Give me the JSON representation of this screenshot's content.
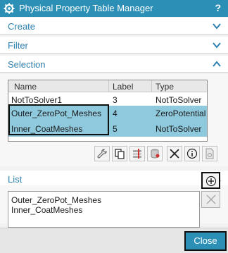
{
  "window": {
    "title": "Physical Property Table Manager",
    "help_label": "?"
  },
  "sections": {
    "create": {
      "label": "Create"
    },
    "filter": {
      "label": "Filter"
    },
    "selection": {
      "label": "Selection"
    },
    "list": {
      "label": "List"
    }
  },
  "table": {
    "columns": [
      "Name",
      "Label",
      "Type"
    ],
    "rows": [
      {
        "name": "NotToSolver1",
        "label": "3",
        "type": "NotToSolver",
        "selected": false
      },
      {
        "name": "Outer_ZeroPot_Meshes",
        "label": "4",
        "type": "ZeroPotential",
        "selected": true
      },
      {
        "name": "Inner_CoatMeshes",
        "label": "5",
        "type": "NotToSolver",
        "selected": true
      }
    ]
  },
  "toolbar": {
    "icons": [
      "wrench-icon",
      "copy-icon",
      "table-edit-icon",
      "database-icon",
      "delete-icon",
      "info-icon",
      "document-icon"
    ]
  },
  "list": {
    "items": [
      "Outer_ZeroPot_Meshes",
      "Inner_CoatMeshes"
    ]
  },
  "footer": {
    "close_label": "Close"
  },
  "colors": {
    "accent": "#2c8fb6",
    "selection": "#8ec9dd",
    "header_text": "#2c7fb0"
  }
}
